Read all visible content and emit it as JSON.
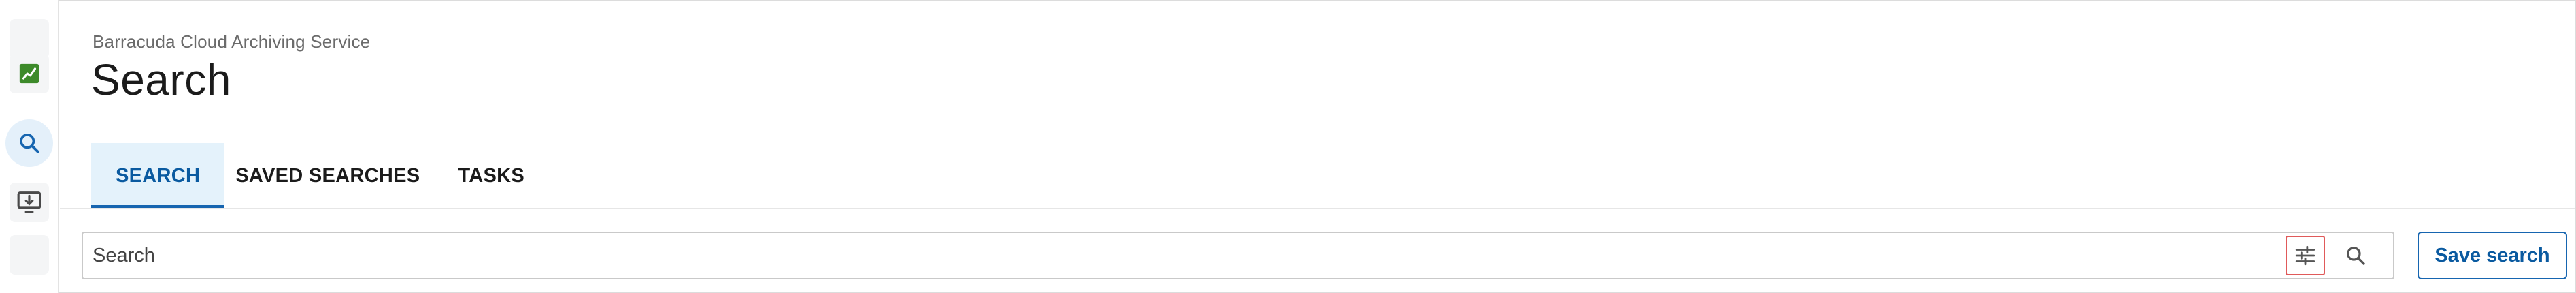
{
  "header": {
    "brand": "Barracuda Cloud Archiving Service",
    "title": "Search"
  },
  "rail": {
    "items": [
      {
        "icon": "blank-icon"
      },
      {
        "icon": "chart-icon",
        "color": "#3d8a2a"
      },
      {
        "icon": "search-icon",
        "color": "#1665b0",
        "active": true
      },
      {
        "icon": "monitor-download-icon",
        "color": "#4a4a4a"
      },
      {
        "icon": "blank-icon"
      }
    ]
  },
  "tabs": [
    {
      "label": "SEARCH",
      "active": true
    },
    {
      "label": "SAVED SEARCHES",
      "active": false
    },
    {
      "label": "TASKS",
      "active": false
    }
  ],
  "search": {
    "placeholder": "Search",
    "value": ""
  },
  "actions": {
    "save_label": "Save search"
  },
  "colors": {
    "accent": "#1665b0",
    "tab_active_bg": "#e4f2fb",
    "filter_outline": "#e05a5a"
  }
}
